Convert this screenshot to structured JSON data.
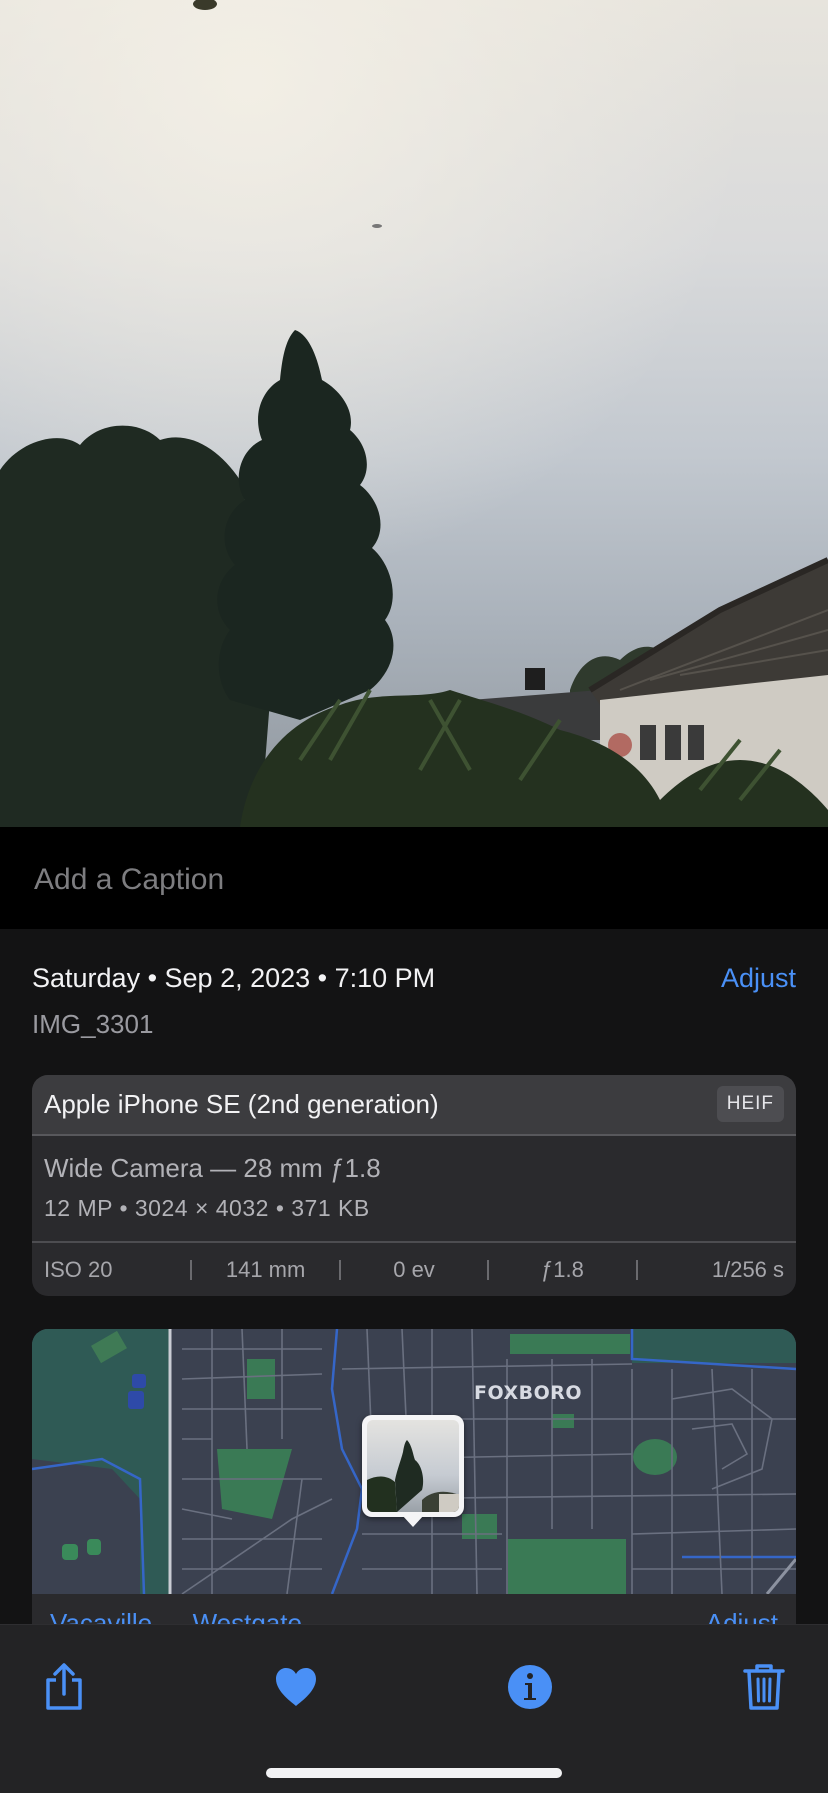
{
  "caption": {
    "placeholder": "Add a Caption",
    "value": ""
  },
  "info": {
    "date_line": "Saturday • Sep 2, 2023 • 7:10 PM",
    "adjust_label": "Adjust",
    "filename": "IMG_3301"
  },
  "exif": {
    "device": "Apple iPhone SE (2nd generation)",
    "format": "HEIF",
    "lens": "Wide Camera — 28 mm ƒ1.8",
    "specs": "12 MP  •  3024 × 4032  •  371 KB",
    "iso": "ISO 20",
    "focal_length": "141 mm",
    "exposure_bias": "0 ev",
    "aperture": "ƒ1.8",
    "shutter": "1/256 s"
  },
  "map": {
    "area_label": "FOXBORO",
    "place_link": "Vacaville — Westgate",
    "adjust_label": "Adjust"
  },
  "toolbar": {
    "share_icon": "share-icon",
    "favorite_icon": "heart-icon",
    "info_icon": "info-icon",
    "delete_icon": "trash-icon",
    "accent_color": "#4a90f6"
  }
}
